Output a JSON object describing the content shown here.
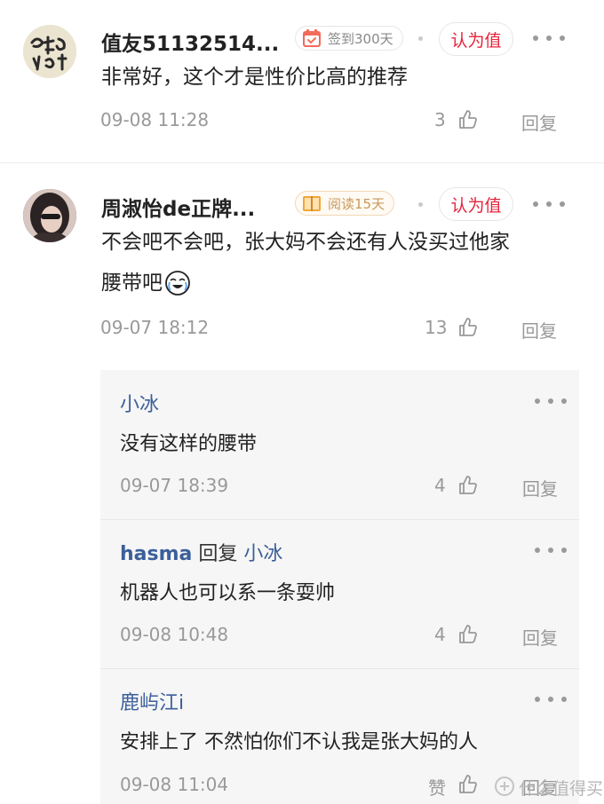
{
  "comments": [
    {
      "username": "值友51132514...",
      "badge": {
        "label": "签到300天",
        "icon": "calendar-check-icon"
      },
      "worth_label": "认为值",
      "text_lines": [
        "非常好，这个才是性价比高的推荐"
      ],
      "time": "09-08 11:28",
      "likes": "3",
      "reply_label": "回复"
    },
    {
      "username": "周淑怡de正牌...",
      "badge": {
        "label": "阅读15天",
        "icon": "book-icon"
      },
      "worth_label": "认为值",
      "text_lines": [
        "不会吧不会吧，张大妈不会还有人没买过他家",
        "腰带吧"
      ],
      "emoji": "crying-laughing-emoji",
      "time": "09-07 18:12",
      "likes": "13",
      "reply_label": "回复",
      "replies": [
        {
          "name": "小冰",
          "text": "没有这样的腰带",
          "time": "09-07 18:39",
          "likes": "4",
          "reply_label": "回复"
        },
        {
          "name": "hasma",
          "reply_word": "回复",
          "reply_to": "小冰",
          "text": "机器人也可以系一条耍帅",
          "time": "09-08 10:48",
          "likes": "4",
          "reply_label": "回复"
        },
        {
          "name": "鹿屿江i",
          "text": "安排上了 不然怕你们不认我是张大妈的人",
          "time": "09-08 11:04",
          "likes": "赞",
          "reply_label": "回复"
        }
      ]
    }
  ],
  "watermark": "什么值得买",
  "colors": {
    "accent_red": "#e5243d",
    "reply_name_blue": "#3b5f9a",
    "meta_gray": "#999999"
  }
}
